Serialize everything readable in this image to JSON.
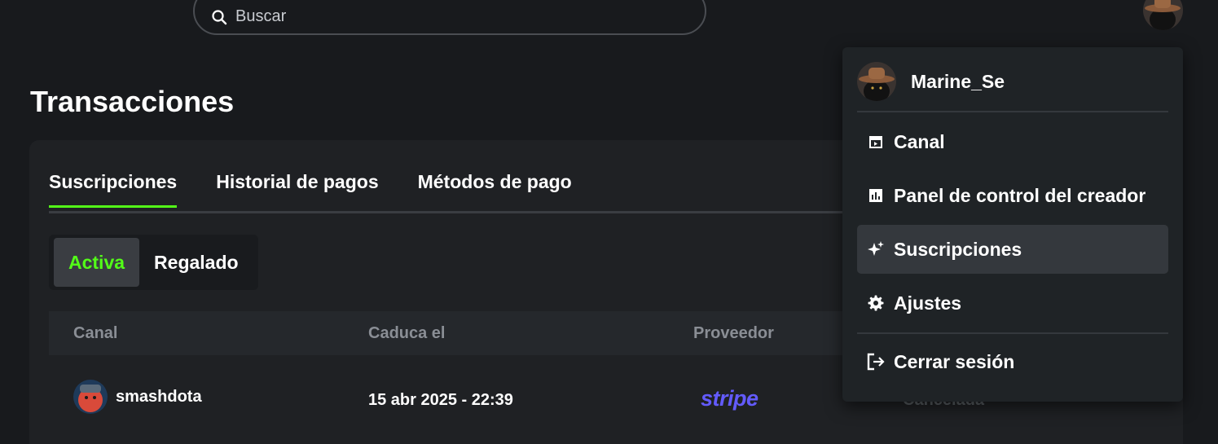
{
  "header": {
    "search_placeholder": "Buscar"
  },
  "page": {
    "title": "Transacciones"
  },
  "tabs": [
    {
      "label": "Suscripciones",
      "active": true
    },
    {
      "label": "Historial de pagos",
      "active": false
    },
    {
      "label": "Métodos de pago",
      "active": false
    }
  ],
  "filters": [
    {
      "label": "Activa",
      "active": true
    },
    {
      "label": "Regalado",
      "active": false
    }
  ],
  "table": {
    "columns": [
      "Canal",
      "Caduca el",
      "Proveedor"
    ],
    "rows": [
      {
        "channel": "smashdota",
        "expires": "15 abr 2025 - 22:39",
        "provider": "stripe",
        "status": "Cancelada"
      }
    ]
  },
  "user_menu": {
    "username": "Marine_Se",
    "items": [
      {
        "label": "Canal",
        "icon": "store-icon"
      },
      {
        "label": "Panel de control del creador",
        "icon": "chart-icon"
      },
      {
        "label": "Suscripciones",
        "icon": "sparkle-icon",
        "highlighted": true
      },
      {
        "label": "Ajustes",
        "icon": "gear-icon"
      },
      {
        "label": "Cerrar sesión",
        "icon": "logout-icon"
      }
    ]
  },
  "colors": {
    "accent": "#53fc18",
    "background": "#181a1d",
    "panel": "#1f2124",
    "stripe": "#635bff"
  }
}
